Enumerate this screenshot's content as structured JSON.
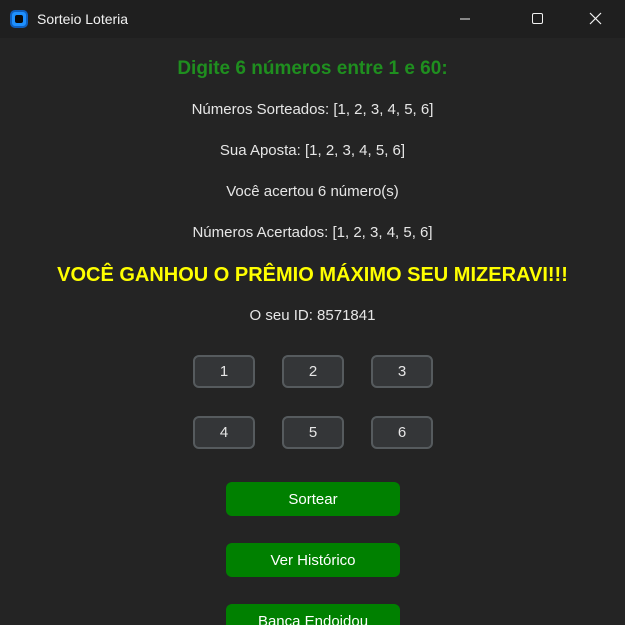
{
  "window": {
    "title": "Sorteio Loteria"
  },
  "form": {
    "heading": "Digite 6 números entre 1 e 60:",
    "drawn_numbers": "Números Sorteados: [1, 2, 3, 4, 5, 6]",
    "bet": "Sua Aposta: [1, 2, 3, 4, 5, 6]",
    "hits_count": "Você acertou 6 número(s)",
    "hit_numbers": "Números Acertados: [1, 2, 3, 4, 5, 6]",
    "banner": "VOCÊ GANHOU O PRÊMIO MÁXIMO SEU MIZERAVI!!!",
    "id_line": "O seu ID: 8571841"
  },
  "inputs": [
    "1",
    "2",
    "3",
    "4",
    "5",
    "6"
  ],
  "buttons": {
    "draw": "Sortear",
    "history": "Ver Histórico",
    "bank": "Banca Endoidou"
  },
  "colors": {
    "heading": "#1f8f1f",
    "banner": "#ffff00",
    "button": "#008000",
    "background": "#242424"
  }
}
